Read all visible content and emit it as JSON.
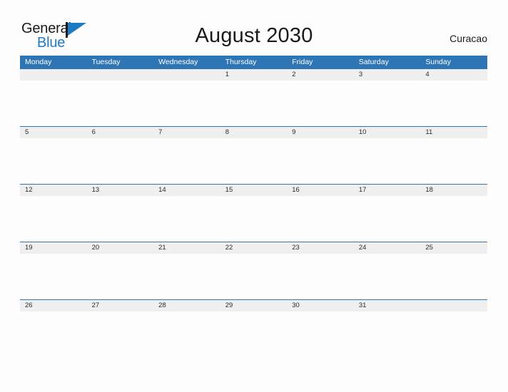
{
  "logo": {
    "text_primary": "General",
    "text_secondary": "Blue",
    "flag_icon": "triangle-flag-icon",
    "primary_color": "#1a1a1a",
    "secondary_color": "#1f7ac4"
  },
  "header": {
    "title": "August 2030",
    "location": "Curacao"
  },
  "colors": {
    "header_blue": "#2e75b6",
    "date_band_gray": "#efefef",
    "page_background": "#fdfdfd",
    "text_dark": "#1a1a1a",
    "header_text": "#ffffff"
  },
  "calendar": {
    "month": "August",
    "year": "2030",
    "weekday_headers": [
      "Monday",
      "Tuesday",
      "Wednesday",
      "Thursday",
      "Friday",
      "Saturday",
      "Sunday"
    ],
    "weeks": [
      [
        "",
        "",
        "",
        "1",
        "2",
        "3",
        "4"
      ],
      [
        "5",
        "6",
        "7",
        "8",
        "9",
        "10",
        "11"
      ],
      [
        "12",
        "13",
        "14",
        "15",
        "16",
        "17",
        "18"
      ],
      [
        "19",
        "20",
        "21",
        "22",
        "23",
        "24",
        "25"
      ],
      [
        "26",
        "27",
        "28",
        "29",
        "30",
        "31",
        ""
      ]
    ]
  }
}
